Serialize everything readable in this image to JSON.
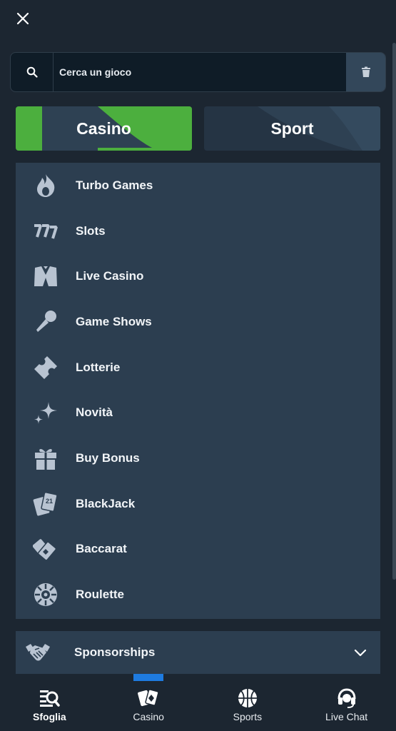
{
  "search": {
    "placeholder": "Cerca un gioco"
  },
  "tabs": [
    {
      "label": "Casino",
      "active": true
    },
    {
      "label": "Sport",
      "active": false
    }
  ],
  "menu": [
    {
      "label": "Turbo Games",
      "icon": "flame-icon"
    },
    {
      "label": "Slots",
      "icon": "slot-777-icon"
    },
    {
      "label": "Live Casino",
      "icon": "dealer-vest-icon"
    },
    {
      "label": "Game Shows",
      "icon": "microphone-icon"
    },
    {
      "label": "Lotterie",
      "icon": "ticket-icon"
    },
    {
      "label": "Novità",
      "icon": "sparkles-icon"
    },
    {
      "label": "Buy Bonus",
      "icon": "gift-icon"
    },
    {
      "label": "BlackJack",
      "icon": "blackjack-cards-icon"
    },
    {
      "label": "Baccarat",
      "icon": "baccarat-cards-icon"
    },
    {
      "label": "Roulette",
      "icon": "roulette-wheel-icon"
    }
  ],
  "sponsor": {
    "label": "Sponsorships",
    "icon": "handshake-icon"
  },
  "bottom_nav": [
    {
      "label": "Sfoglia",
      "icon": "browse-icon",
      "active": true
    },
    {
      "label": "Casino",
      "icon": "casino-cards-icon",
      "active": false
    },
    {
      "label": "Sports",
      "icon": "basketball-icon",
      "active": false
    },
    {
      "label": "Live Chat",
      "icon": "headset-icon",
      "active": false
    }
  ],
  "colors": {
    "background": "#1c2631",
    "panel": "#2c3e50",
    "accent_green": "#4caf3e",
    "accent_blue": "#1e7be0",
    "icon": "#b8c3d1"
  }
}
